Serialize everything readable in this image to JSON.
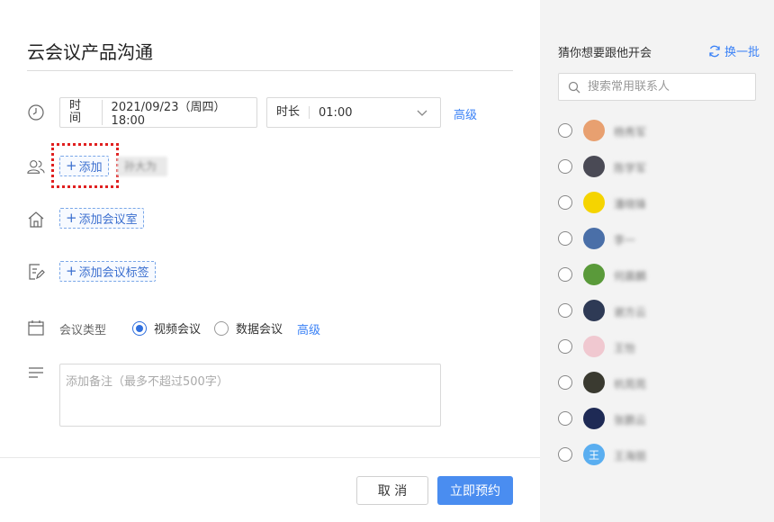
{
  "meeting": {
    "title": "云会议产品沟通",
    "time_label": "时间",
    "time_value": "2021/09/23（周四）18:00",
    "duration_label": "时长",
    "duration_value": "01:00",
    "advanced_link": "高级",
    "add_participant": "添加",
    "participant_chip": "孙大为",
    "add_room": "添加会议室",
    "add_tag": "添加会议标签",
    "type_label": "会议类型",
    "type_options": [
      "视频会议",
      "数据会议"
    ],
    "type_selected": "视频会议",
    "type_advanced_link": "高级",
    "notes_placeholder": "添加备注（最多不超过500字）",
    "cancel_button": "取 消",
    "submit_button": "立即预约"
  },
  "sidebar": {
    "title": "猜你想要跟他开会",
    "refresh_label": "换一批",
    "search_placeholder": "搜索常用联系人",
    "contacts": [
      {
        "name": "杨秀军",
        "avatar_color": "#e8a070"
      },
      {
        "name": "陈学军",
        "avatar_color": "#4a4a55"
      },
      {
        "name": "潘晓锋",
        "avatar_color": "#f5d400"
      },
      {
        "name": "李一",
        "avatar_color": "#4a6fa8"
      },
      {
        "name": "何晨麟",
        "avatar_color": "#5a9a3a"
      },
      {
        "name": "谢方云",
        "avatar_color": "#2e3a55"
      },
      {
        "name": "王怡",
        "avatar_color": "#f0c8d0"
      },
      {
        "name": "杭苑苑",
        "avatar_color": "#3a3a30"
      },
      {
        "name": "张鹏云",
        "avatar_color": "#1e2a55"
      },
      {
        "name": "王海丽",
        "avatar_color": "#5aaef0",
        "avatar_text": "王"
      }
    ]
  },
  "colors": {
    "accent": "#4a8df0",
    "link": "#3b82f6",
    "highlight": "#e02020",
    "sidebar_bg": "#f3f3f3"
  }
}
